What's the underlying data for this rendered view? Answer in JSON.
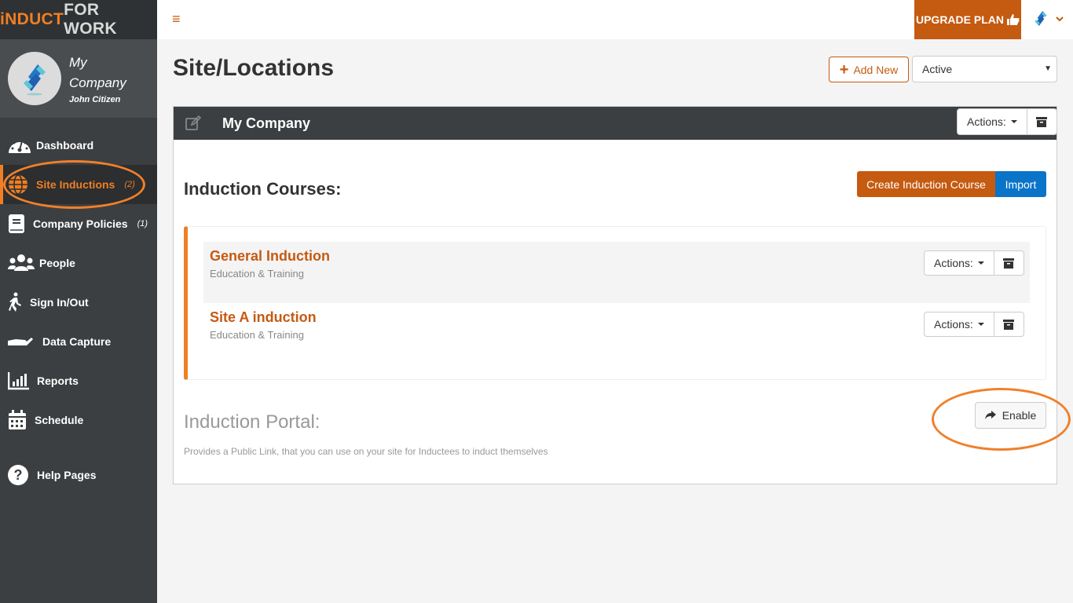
{
  "brand": {
    "part1": "iNDUCT",
    "part2": "FOR WORK"
  },
  "profile": {
    "company": "My Company",
    "user": "John Citizen"
  },
  "sidebar": {
    "items": [
      {
        "label": "Dashboard",
        "icon": "dashboard-icon",
        "count": ""
      },
      {
        "label": "Site Inductions",
        "icon": "globe-icon",
        "count": "(2)",
        "active": true
      },
      {
        "label": "Company Policies",
        "icon": "book-icon",
        "count": "(1)"
      },
      {
        "label": "People",
        "icon": "people-icon",
        "count": ""
      },
      {
        "label": "Sign In/Out",
        "icon": "walking-icon",
        "count": ""
      },
      {
        "label": "Data Capture",
        "icon": "hand-icon",
        "count": ""
      },
      {
        "label": "Reports",
        "icon": "bar-chart-icon",
        "count": ""
      },
      {
        "label": "Schedule",
        "icon": "calendar-icon",
        "count": ""
      },
      {
        "label": "Help Pages",
        "icon": "question-icon",
        "count": ""
      }
    ]
  },
  "topbar": {
    "menu_icon": "≡",
    "upgrade_label": "UPGRADE PLAN"
  },
  "page": {
    "title": "Site/Locations",
    "add_new_label": "Add New",
    "status_filter": "Active"
  },
  "site": {
    "name": "My Company",
    "actions_label": "Actions:",
    "courses_title": "Induction Courses:",
    "create_label": "Create Induction Course",
    "import_label": "Import",
    "courses": [
      {
        "name": "General Induction",
        "category": "Education & Training",
        "actions_label": "Actions:"
      },
      {
        "name": "Site A induction",
        "category": "Education & Training",
        "actions_label": "Actions:"
      }
    ],
    "portal_title": "Induction Portal:",
    "portal_desc": "Provides a Public Link, that you can use on your site for Inductees to induct themselves",
    "enable_label": "Enable"
  },
  "colors": {
    "accent": "#c55a11",
    "highlight": "#f07f23",
    "import": "#0a74c8",
    "sidebar": "#3c3f41"
  }
}
